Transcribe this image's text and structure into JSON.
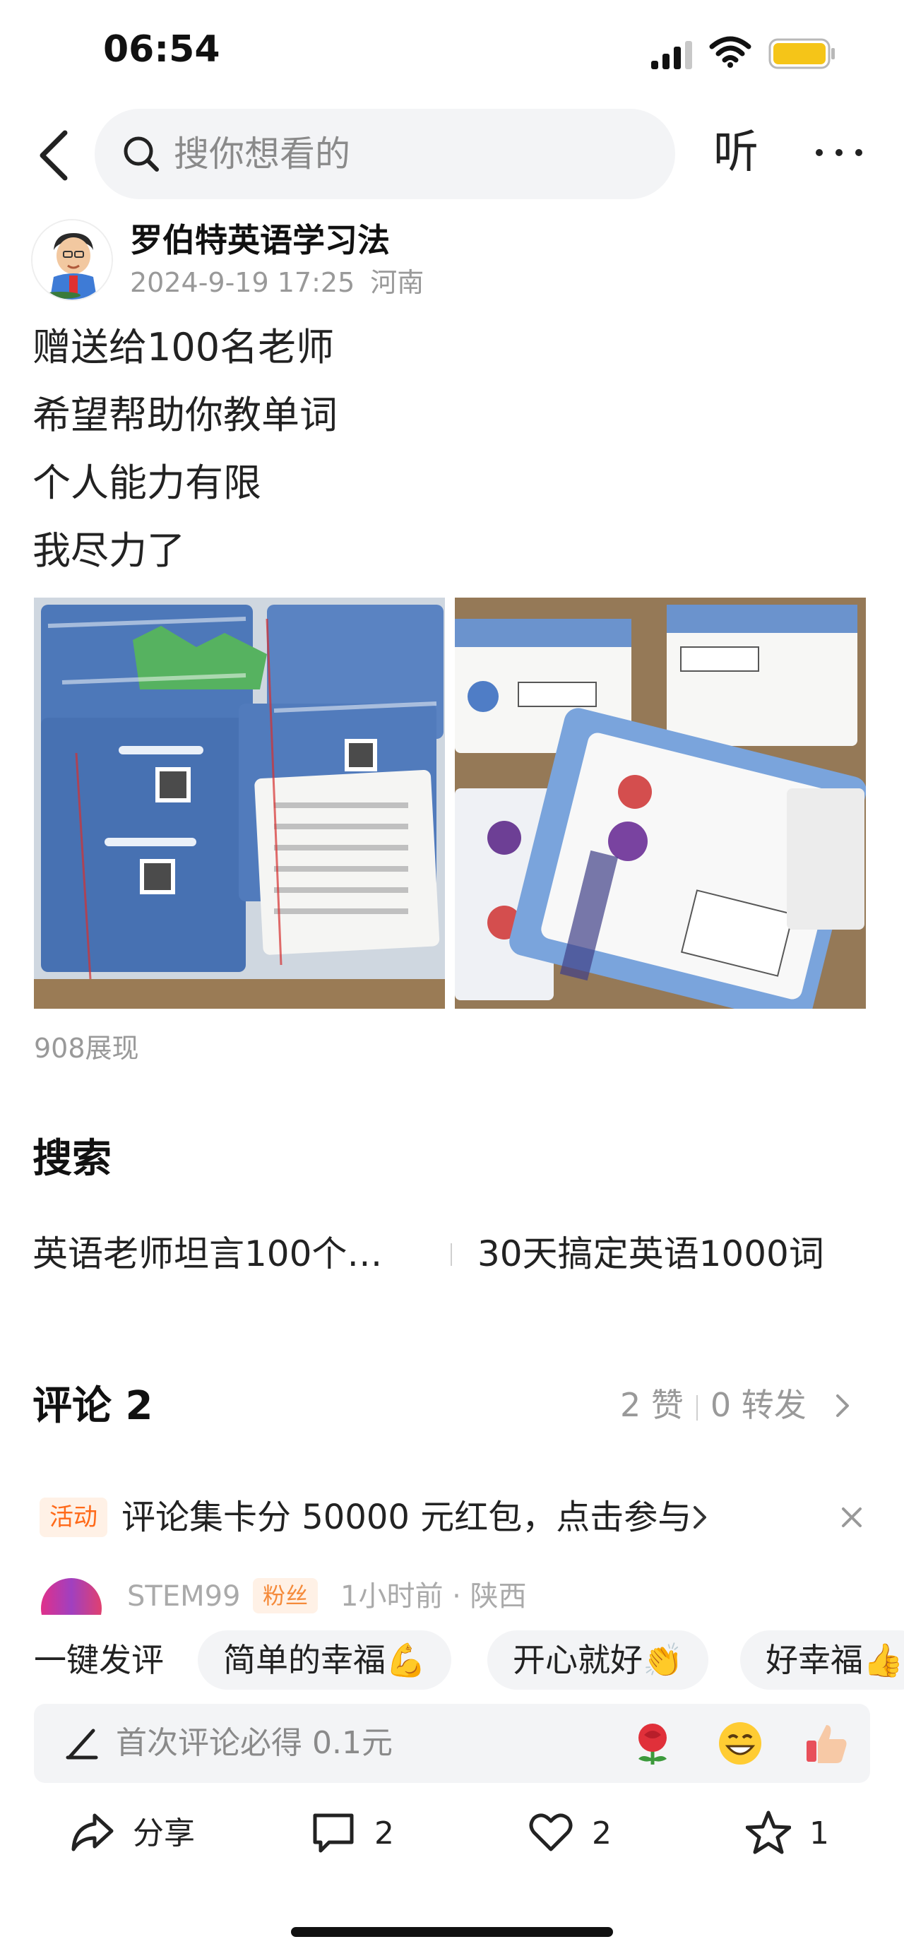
{
  "status_bar": {
    "time": "06:54"
  },
  "nav": {
    "search_placeholder": "搜你想看的",
    "listen_label": "听"
  },
  "author": {
    "name": "罗伯特英语学习法",
    "date": "2024-9-19 17:25",
    "location": "河南"
  },
  "post": {
    "lines": [
      "赠送给100名老师",
      "希望帮助你教单词",
      "个人能力有限",
      "我尽力了"
    ],
    "views": "908展现"
  },
  "search_section": {
    "title": "搜索",
    "items": [
      "英语老师坦言100个…",
      "30天搞定英语1000词"
    ]
  },
  "comments": {
    "title": "评论 2",
    "likes": "2 赞",
    "reposts": "0 转发",
    "activity": {
      "badge": "活动",
      "text": "评论集卡分 50000 元红包，点击参与"
    },
    "first": {
      "user": "STEM99",
      "badge": "粉丝",
      "time": "1小时前",
      "region": "陕西"
    }
  },
  "quick_reply": {
    "label": "一键发评",
    "chips": [
      "简单的幸福💪",
      "开心就好👏",
      "好幸福👍"
    ]
  },
  "comment_input": {
    "placeholder": "首次评论必得 0.1元",
    "emojis": [
      "rose-emoji",
      "grinning-emoji",
      "thumbs-up-emoji"
    ]
  },
  "actions": {
    "share": "分享",
    "comment": "2",
    "like": "2",
    "favorite": "1"
  },
  "colors": {
    "accent_orange": "#ff6a1a",
    "badge_bg": "#fff1e6",
    "muted_text": "#999999",
    "battery": "#f5c518"
  }
}
